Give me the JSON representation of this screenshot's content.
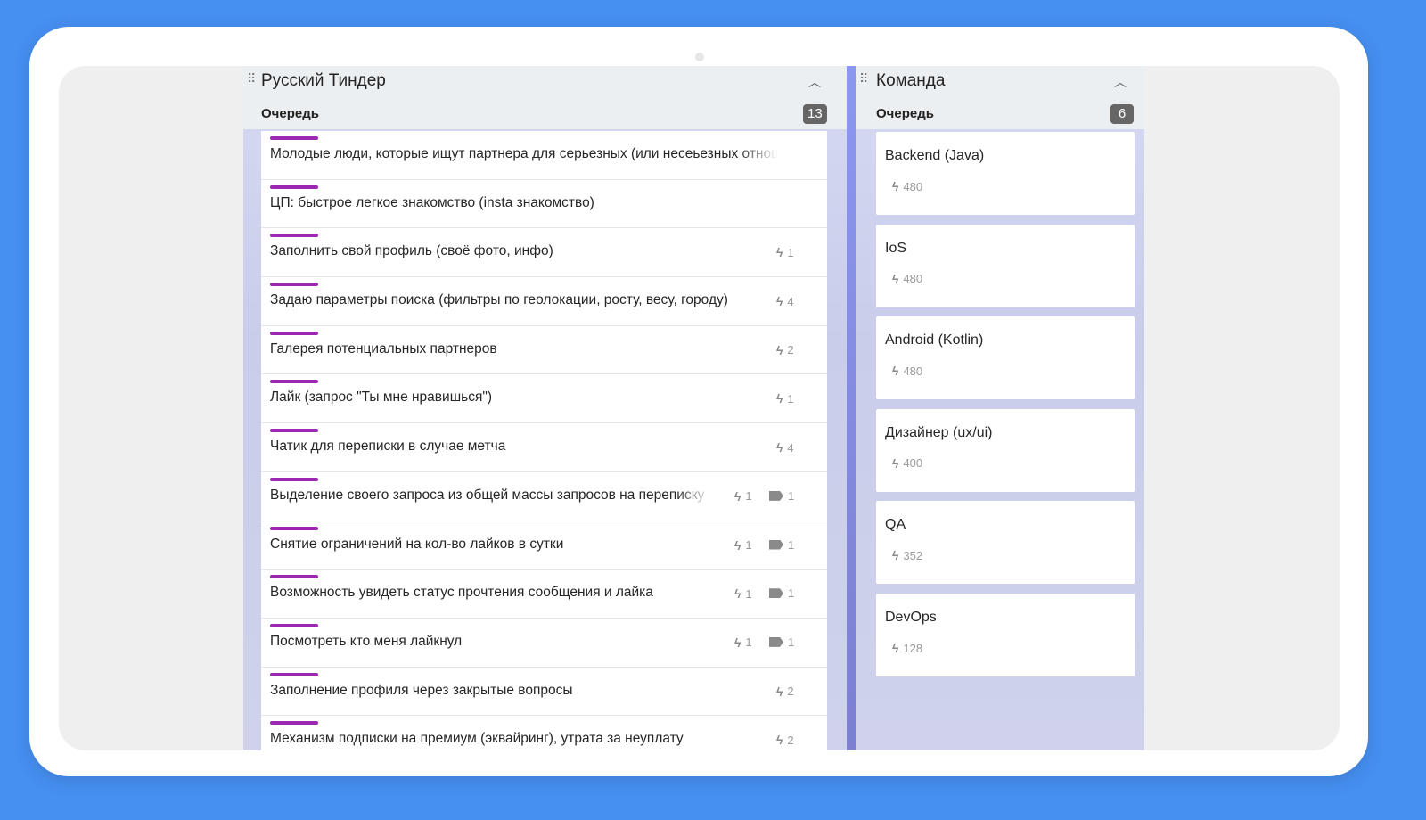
{
  "colors": {
    "background": "#4690f2",
    "accent_bar": "#9c27b0",
    "badge": "#666666"
  },
  "board": {
    "title": "Русский Тиндер",
    "queue_label": "Очередь",
    "queue_count": "13",
    "items": [
      {
        "text": "Молодые люди, которые ищут партнера для серьезных (или несеьезных отношений)",
        "points": null,
        "tags": null
      },
      {
        "text": "ЦП: быстрое легкое знакомство (insta знакомство)",
        "points": null,
        "tags": null
      },
      {
        "text": "Заполнить свой профиль (своё фото, инфо)",
        "points": "1",
        "tags": null
      },
      {
        "text": "Задаю параметры поиска (фильтры по геолокации, росту, весу, городу)",
        "points": "4",
        "tags": null
      },
      {
        "text": "Галерея потенциальных партнеров",
        "points": "2",
        "tags": null
      },
      {
        "text": "Лайк (запрос \"Ты мне нравишься\")",
        "points": "1",
        "tags": null
      },
      {
        "text": "Чатик для переписки в случае метча",
        "points": "4",
        "tags": null
      },
      {
        "text": "Выделение своего запроса из общей массы запросов на переписку",
        "points": "1",
        "tags": "1"
      },
      {
        "text": "Снятие ограничений на кол-во лайков в сутки",
        "points": "1",
        "tags": "1"
      },
      {
        "text": "Возможность увидеть статус прочтения сообщения и лайка",
        "points": "1",
        "tags": "1"
      },
      {
        "text": "Посмотреть кто меня лайкнул",
        "points": "1",
        "tags": "1"
      },
      {
        "text": "Заполнение профиля через закрытые вопросы",
        "points": "2",
        "tags": null
      },
      {
        "text": "Механизм подписки на премиум (эквайринг), утрата за неуплату",
        "points": "2",
        "tags": null
      }
    ]
  },
  "team": {
    "title": "Команда",
    "queue_label": "Очередь",
    "queue_count": "6",
    "members": [
      {
        "name": "Backend (Java)",
        "points": "480"
      },
      {
        "name": "IoS",
        "points": "480"
      },
      {
        "name": "Android (Kotlin)",
        "points": "480"
      },
      {
        "name": "Дизайнер (ux/ui)",
        "points": "400"
      },
      {
        "name": "QA",
        "points": "352"
      },
      {
        "name": "DevOps",
        "points": "128"
      }
    ]
  }
}
